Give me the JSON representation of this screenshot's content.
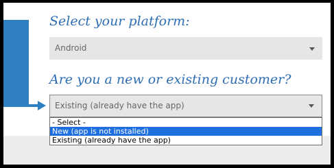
{
  "platform_section": {
    "heading": "Select your platform:",
    "selected_value": "Android",
    "dropdown_icon": "chevron-down-icon"
  },
  "customer_section": {
    "heading": "Are you a new or existing customer?",
    "selected_value": "Existing (already have the app)",
    "dropdown_icon": "chevron-down-icon",
    "options": [
      {
        "label": "- Select -",
        "highlighted": false
      },
      {
        "label": "New (app is not installed)",
        "highlighted": true
      },
      {
        "label": "Existing (already have the app)",
        "highlighted": false
      }
    ]
  },
  "colors": {
    "accent": "#2d7fc1",
    "heading": "#2d6db3",
    "select_background": "#e6e6e6",
    "highlight": "#1e6fe0"
  }
}
